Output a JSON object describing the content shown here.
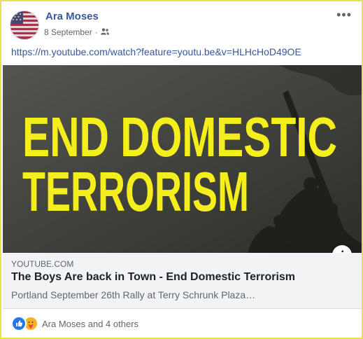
{
  "post": {
    "author": "Ara Moses",
    "date": "8 September",
    "separator": "·",
    "audience_icon": "friends-icon",
    "more_icon": "more-options-icon",
    "more_glyph": "•••",
    "link_url": "https://m.youtube.com/watch?feature=youtu.be&v=HLHcHoD49OE"
  },
  "preview": {
    "image_text_line1": "END DOMESTIC",
    "image_text_line2": "TERRORISM",
    "text_color": "#f4ee1c",
    "info_glyph": "i",
    "domain": "YOUTUBE.COM",
    "title": "The Boys Are back in Town - End Domestic Terrorism",
    "description": "Portland September 26th Rally at Terry Schrunk Plaza…"
  },
  "reactions": {
    "icons": [
      "like-icon",
      "care-icon"
    ],
    "summary": "Ara Moses and 4 others"
  },
  "colors": {
    "link": "#385898",
    "highlight_border": "#e7e34a",
    "like_blue": "#2078f4"
  }
}
